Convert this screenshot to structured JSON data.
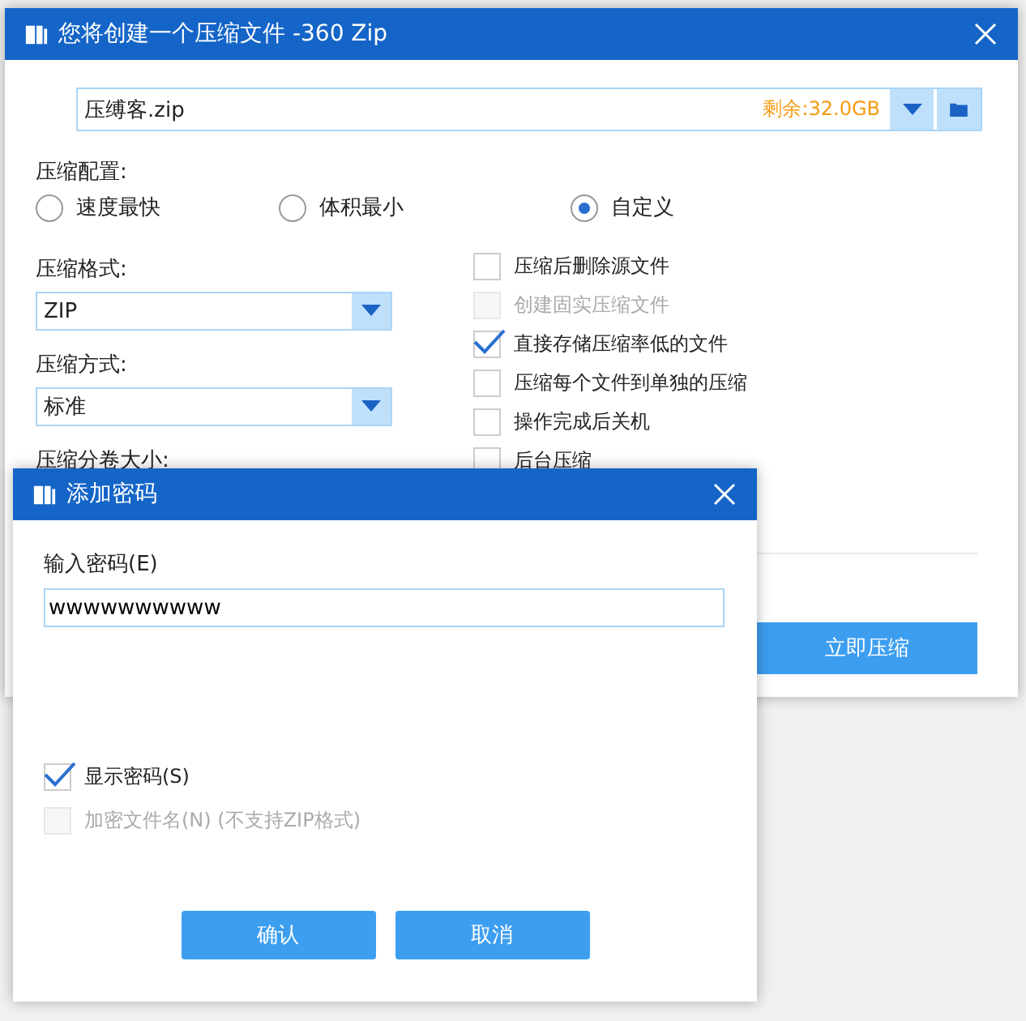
{
  "main_window": {
    "title": "您将创建一个压缩文件 -360 Zip",
    "file": {
      "value": "压缚客.zip",
      "free_space": "剩余:32.0GB"
    },
    "config_label": "压缩配置:",
    "presets": [
      {
        "label": "速度最快",
        "selected": false
      },
      {
        "label": "体积最小",
        "selected": false
      },
      {
        "label": "自定义",
        "selected": true
      }
    ],
    "fields": [
      {
        "label": "压缩格式:",
        "value": "ZIP"
      },
      {
        "label": "压缩方式:",
        "value": "标准"
      }
    ],
    "split_label": "压缩分卷大小:",
    "options": [
      {
        "label": "压缩后删除源文件",
        "checked": false,
        "disabled": false
      },
      {
        "label": "创建固实压缩文件",
        "checked": false,
        "disabled": true
      },
      {
        "label": "直接存储压缩率低的文件",
        "checked": true,
        "disabled": false
      },
      {
        "label": "压缩每个文件到单独的压缩",
        "checked": false,
        "disabled": false
      },
      {
        "label": "操作完成后关机",
        "checked": false,
        "disabled": false
      },
      {
        "label": "后台压缩",
        "checked": false,
        "disabled": false
      }
    ],
    "start_button": "立即压缩"
  },
  "password_dialog": {
    "title": "添加密码",
    "password_label": "输入密码(E)",
    "password_value": "wwwwwwwwww",
    "options": [
      {
        "label": "显示密码(S)",
        "checked": true,
        "disabled": false
      },
      {
        "label": "加密文件名(N) (不支持ZIP格式)",
        "checked": false,
        "disabled": true
      }
    ],
    "buttons": [
      "确认",
      "取消"
    ]
  }
}
